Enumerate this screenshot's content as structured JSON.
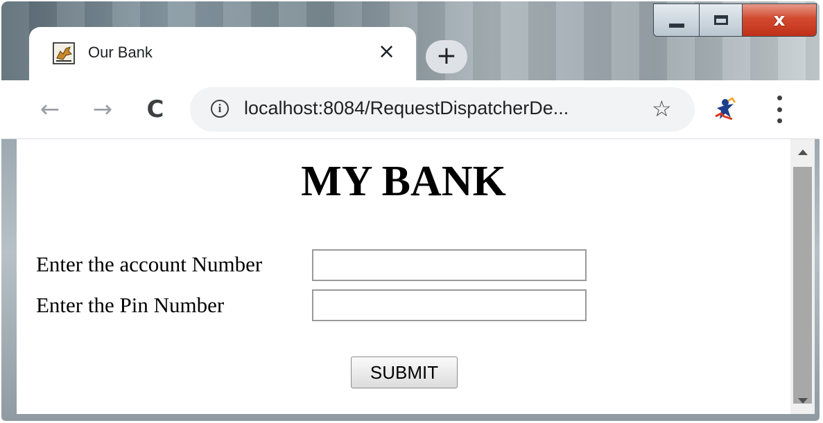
{
  "browser": {
    "tab": {
      "title": "Our Bank",
      "close_glyph": "×",
      "favicon": "tomcat-favicon-icon"
    },
    "new_tab_glyph": "+",
    "toolbar": {
      "back_glyph": "←",
      "forward_glyph": "→",
      "reload_glyph": "C",
      "url": "localhost:8084/RequestDispatcherDe...",
      "info_glyph": "i",
      "star_glyph": "☆"
    },
    "window_controls": {
      "close_glyph": "x"
    }
  },
  "page": {
    "heading": "MY BANK",
    "form": {
      "account_label": "Enter the account Number",
      "account_value": "",
      "pin_label": "Enter the Pin Number",
      "pin_value": "",
      "submit_label": "SUBMIT"
    }
  },
  "colors": {
    "close_button": "#d24a2f",
    "tab_background": "#ffffff",
    "omnibox_background": "#f1f3f4",
    "scrollbar_thumb": "#a8a8a8"
  }
}
